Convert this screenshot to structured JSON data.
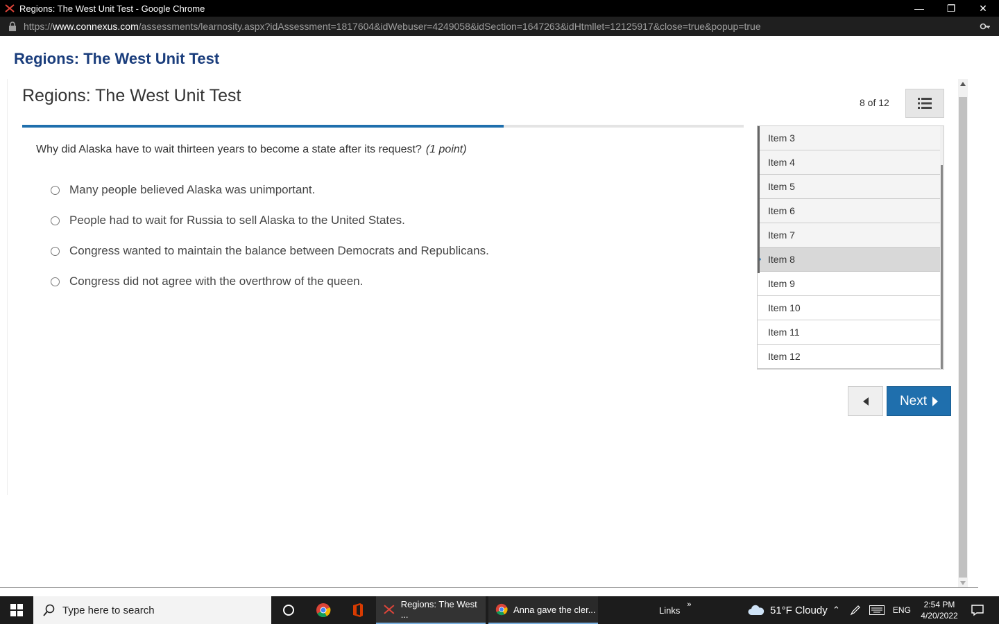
{
  "window": {
    "title": "Regions: The West Unit Test - Google Chrome",
    "minimize_glyph": "—",
    "maximize_glyph": "❐",
    "close_glyph": "✕"
  },
  "url": {
    "prefix": "https://",
    "host": "www.connexus.com",
    "path": "/assessments/learnosity.aspx?idAssessment=1817604&idWebuser=4249058&idSection=1647263&idHtmllet=12125917&close=true&popup=true"
  },
  "page": {
    "brand_title": "Regions: The West Unit Test",
    "test_title": "Regions: The West Unit Test",
    "counter": "8 of 12",
    "progress_fraction": 0.667,
    "question": {
      "text": "Why did Alaska have to wait thirteen years to become a state after its request?",
      "points": "(1 point)"
    },
    "options": [
      "Many people believed Alaska was unimportant.",
      "People had to wait for Russia to sell Alaska to the United States.",
      "Congress wanted to maintain the balance between Democrats and Republicans.",
      "Congress did not agree with the overthrow of the queen."
    ],
    "items": [
      {
        "label": "Item 3",
        "state": "visited"
      },
      {
        "label": "Item 4",
        "state": "visited"
      },
      {
        "label": "Item 5",
        "state": "visited"
      },
      {
        "label": "Item 6",
        "state": "visited"
      },
      {
        "label": "Item 7",
        "state": "visited"
      },
      {
        "label": "Item 8",
        "state": "current"
      },
      {
        "label": "Item 9",
        "state": "unvisited"
      },
      {
        "label": "Item 10",
        "state": "unvisited"
      },
      {
        "label": "Item 11",
        "state": "unvisited"
      },
      {
        "label": "Item 12",
        "state": "unvisited"
      }
    ],
    "next_label": "Next"
  },
  "taskbar": {
    "search_placeholder": "Type here to search",
    "active_app": "Regions: The West ...",
    "second_app": "Anna gave the cler...",
    "links": "Links",
    "weather": "51°F  Cloudy",
    "lang": "ENG",
    "time": "2:54 PM",
    "date": "4/20/2022"
  },
  "colors": {
    "accent": "#1f6fad",
    "brand": "#1a3d7c"
  }
}
